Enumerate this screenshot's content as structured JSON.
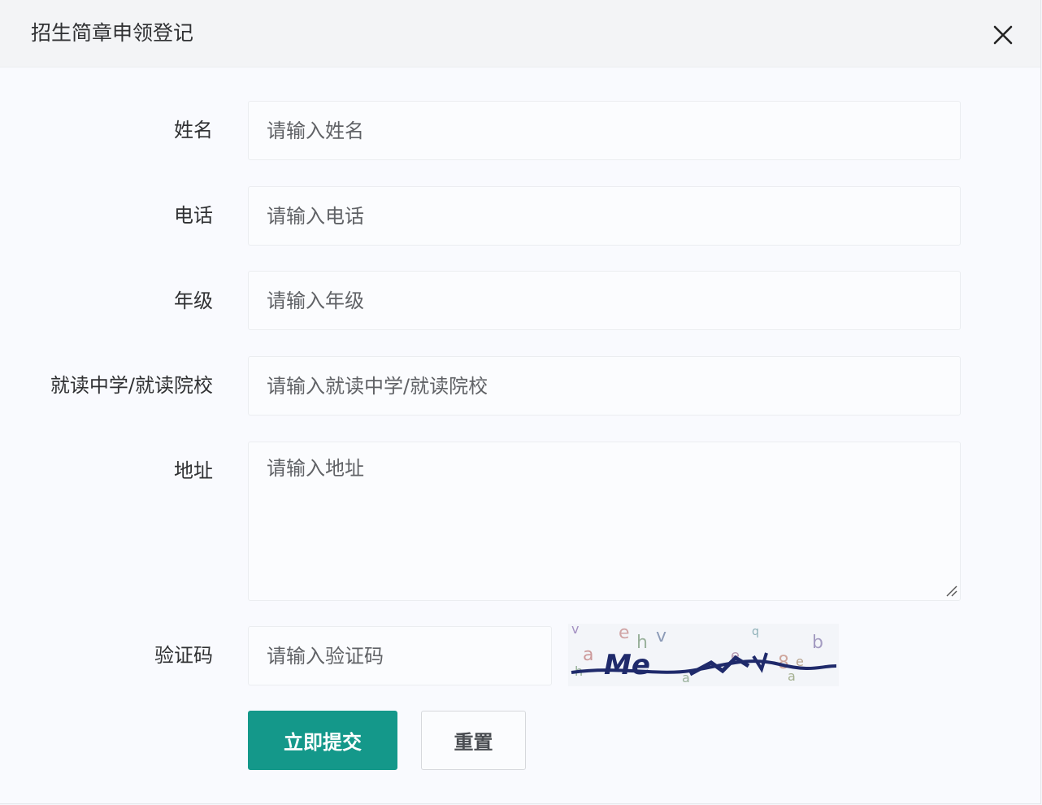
{
  "dialog": {
    "title": "招生简章申领登记",
    "close_icon": "close-icon"
  },
  "form": {
    "name": {
      "label": "姓名",
      "placeholder": "请输入姓名"
    },
    "phone": {
      "label": "电话",
      "placeholder": "请输入电话"
    },
    "grade": {
      "label": "年级",
      "placeholder": "请输入年级"
    },
    "school": {
      "label": "就读中学/就读院校",
      "placeholder": "请输入就读中学/就读院校"
    },
    "address": {
      "label": "地址",
      "placeholder": "请输入地址"
    },
    "captcha": {
      "label": "验证码",
      "placeholder": "请输入验证码",
      "image_text": "Me"
    }
  },
  "actions": {
    "submit_label": "立即提交",
    "reset_label": "重置"
  },
  "colors": {
    "primary": "#14988a",
    "captcha_ink": "#1f2a6b"
  }
}
